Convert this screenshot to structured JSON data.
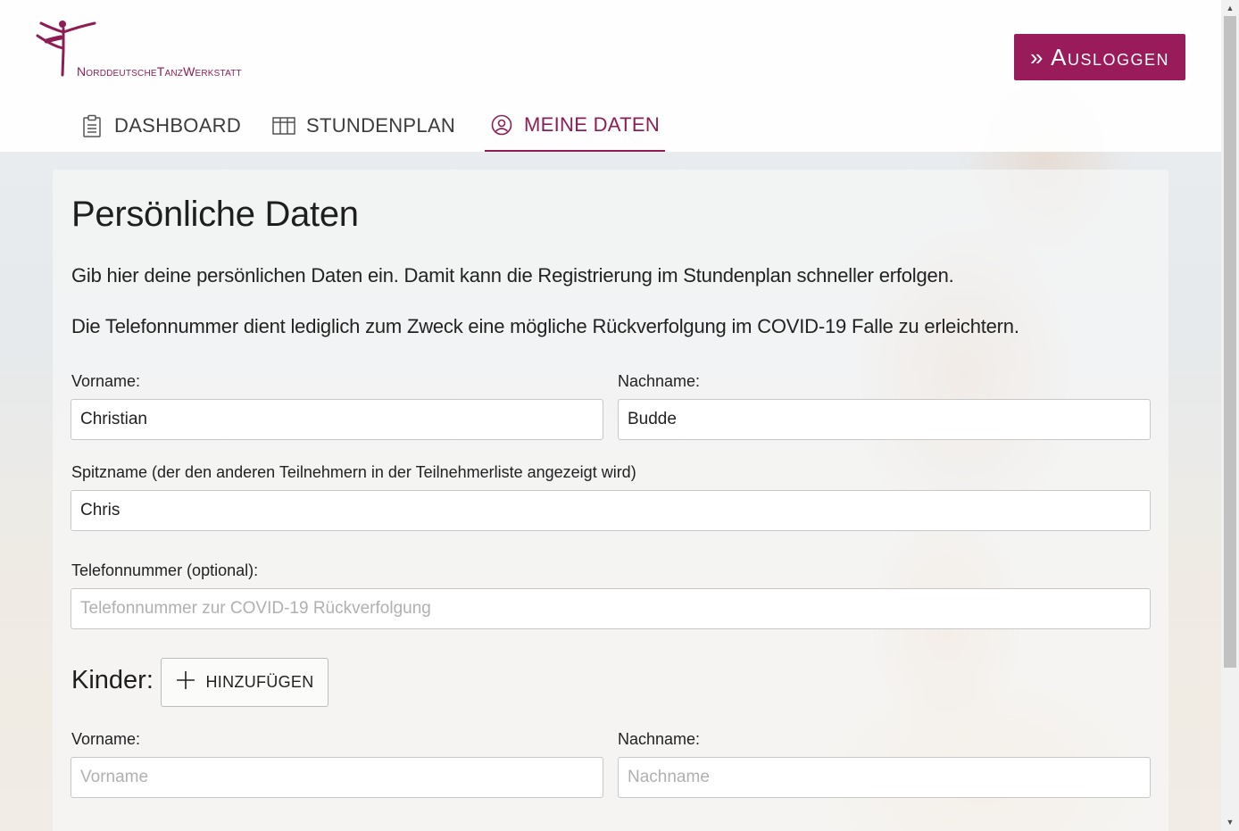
{
  "brand": {
    "name_part1": "NorddeutscheTanz",
    "name_part2": "Werkstatt",
    "accent_color": "#8e1d55"
  },
  "header": {
    "logout_label": "» Ausloggen"
  },
  "tabs": [
    {
      "label": "DASHBOARD",
      "icon": "clipboard-icon",
      "active": false
    },
    {
      "label": "STUNDENPLAN",
      "icon": "table-icon",
      "active": false
    },
    {
      "label": "MEINE DATEN",
      "icon": "user-circle-icon",
      "active": true
    }
  ],
  "form": {
    "title": "Persönliche Daten",
    "intro": "Gib hier deine persönlichen Daten ein. Damit kann die Registrierung im Stundenplan schneller erfolgen.",
    "covid_note": "Die Telefonnummer dient lediglich zum Zweck eine mögliche Rückverfolgung im COVID-19 Falle zu erleichtern.",
    "vorname_label": "Vorname:",
    "vorname_value": "Christian",
    "nachname_label": "Nachname:",
    "nachname_value": "Budde",
    "spitzname_label": "Spitzname (der den anderen Teilnehmern in der Teilnehmerliste angezeigt wird)",
    "spitzname_value": "Chris",
    "telefon_label": "Telefonnummer (optional):",
    "telefon_value": "",
    "telefon_placeholder": "Telefonnummer zur COVID-19 Rückverfolgung"
  },
  "kinder": {
    "label": "Kinder:",
    "add_label": "HINZUFÜGEN",
    "vorname_label": "Vorname:",
    "vorname_placeholder": "Vorname",
    "nachname_label": "Nachname:",
    "nachname_placeholder": "Nachname"
  }
}
